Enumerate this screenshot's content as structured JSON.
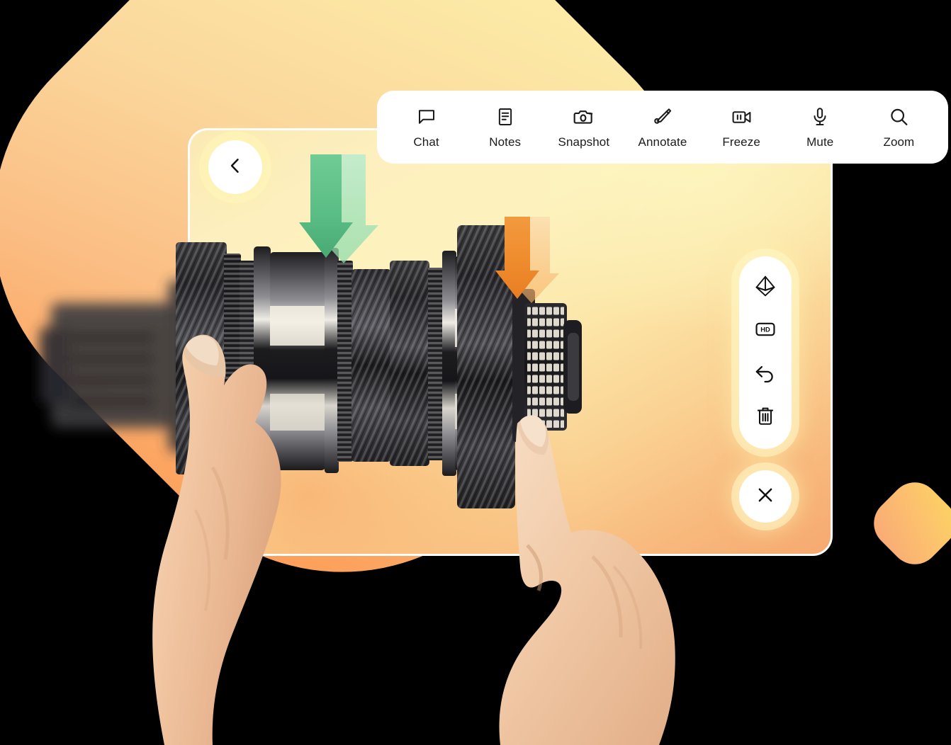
{
  "app": {
    "scene_title": "AR remote assistance session",
    "subject": "automotive transmission gear cluster"
  },
  "toolbar": {
    "position": "top",
    "items": [
      {
        "id": "chat",
        "label": "Chat",
        "icon": "chat-bubble-icon"
      },
      {
        "id": "notes",
        "label": "Notes",
        "icon": "notes-document-icon"
      },
      {
        "id": "snapshot",
        "label": "Snapshot",
        "icon": "camera-icon"
      },
      {
        "id": "annotate",
        "label": "Annotate",
        "icon": "pen-annotate-icon"
      },
      {
        "id": "freeze",
        "label": "Freeze",
        "icon": "video-pause-icon"
      },
      {
        "id": "mute",
        "label": "Mute",
        "icon": "microphone-icon"
      },
      {
        "id": "zoom",
        "label": "Zoom",
        "icon": "magnifier-icon"
      }
    ]
  },
  "back_button": {
    "icon": "chevron-left-icon",
    "label": "Back"
  },
  "right_rail": {
    "position": "right",
    "items": [
      {
        "id": "model-3d",
        "label": "3D model",
        "icon": "octahedron-3d-icon"
      },
      {
        "id": "hd",
        "label": "HD",
        "icon": "hd-badge-icon"
      },
      {
        "id": "undo",
        "label": "Undo",
        "icon": "undo-arrow-icon"
      },
      {
        "id": "delete",
        "label": "Delete",
        "icon": "trash-can-icon"
      }
    ]
  },
  "close_button": {
    "icon": "close-x-icon",
    "label": "Close"
  },
  "annotations": [
    {
      "id": "arrow-green",
      "type": "arrow",
      "direction": "down",
      "color": "#6FCF97",
      "target": "input shaft gear"
    },
    {
      "id": "arrow-orange",
      "type": "arrow",
      "direction": "down",
      "color": "#F59233",
      "target": "tapered roller bearing"
    }
  ],
  "colors": {
    "accent_yellow": "#FDF2BE",
    "accent_orange": "#F79E5C",
    "arrow_green": "#6FCF97",
    "arrow_orange": "#F59233",
    "surface_white": "#FFFFFF",
    "icon_ink": "#1B1B1B",
    "backdrop": "#000000"
  }
}
